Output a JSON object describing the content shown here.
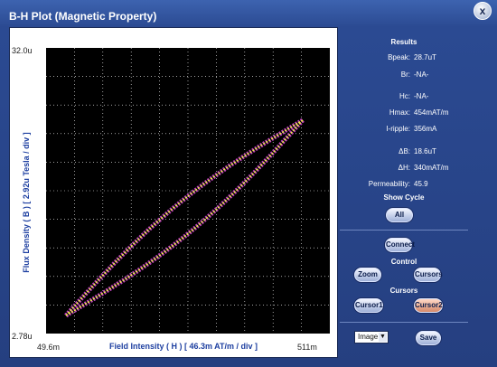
{
  "window": {
    "title": "B-H Plot (Magnetic Property)",
    "close_label": "x"
  },
  "plot": {
    "y_top_label": "32.0u",
    "y_bottom_label": "2.78u",
    "x_left_label": "49.6m",
    "x_right_label": "511m",
    "x_title": "Field Intensity ( H )  [ 46.3m AT/m / div ]",
    "y_title": "Flux Density ( B )  [ 2.92u Tesla / div ]",
    "colors": {
      "background": "#000000",
      "grid": "#ffffff",
      "trace_primary": "#c040c0",
      "trace_secondary": "#f0f040"
    }
  },
  "results": {
    "heading": "Results",
    "rows": [
      {
        "label": "Bpeak:",
        "value": "28.7uT"
      },
      {
        "label": "Br:",
        "value": "-NA-"
      },
      {
        "label": "Hc:",
        "value": "-NA-"
      },
      {
        "label": "Hmax:",
        "value": "454mAT/m"
      },
      {
        "label": "I-ripple:",
        "value": "356mA"
      },
      {
        "label": "ΔB:",
        "value": "18.6uT"
      },
      {
        "label": "ΔH:",
        "value": "340mAT/m"
      },
      {
        "label": "Permeability:",
        "value": "45.9"
      }
    ]
  },
  "show_cycle": {
    "heading": "Show Cycle",
    "all_label": "All"
  },
  "control": {
    "connect_label": "Connect",
    "heading": "Control",
    "zoom_label": "Zoom",
    "cursors_label": "Cursors"
  },
  "cursors": {
    "heading": "Cursors",
    "cursor1_label": "Cursor1",
    "cursor2_label": "Cursor2"
  },
  "footer": {
    "format_selected": "Image",
    "save_label": "Save"
  }
}
